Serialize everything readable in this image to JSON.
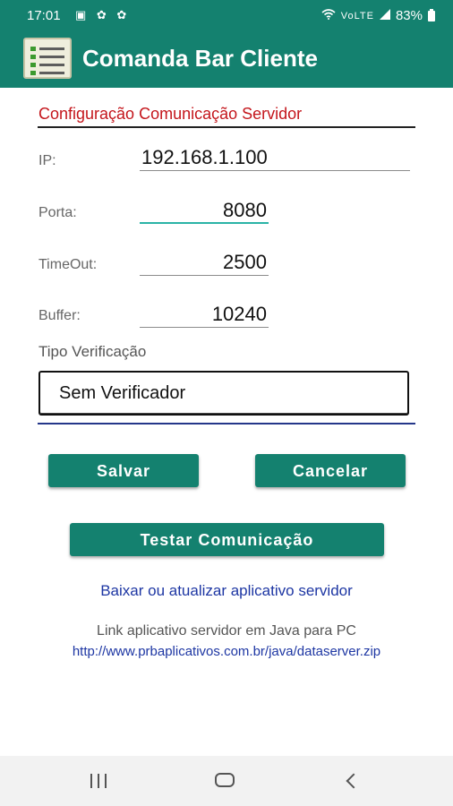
{
  "status": {
    "time": "17:01",
    "notification_icons": "▣ ✿ ✿",
    "network": "VoLTE",
    "battery": "83%"
  },
  "app": {
    "title": "Comanda Bar Cliente"
  },
  "form": {
    "section_title": "Configuração Comunicação Servidor",
    "ip": {
      "label": "IP:",
      "value": "192.168.1.100"
    },
    "porta": {
      "label": "Porta:",
      "value": "8080"
    },
    "timeout": {
      "label": "TimeOut:",
      "value": "2500"
    },
    "buffer": {
      "label": "Buffer:",
      "value": "10240"
    },
    "tipo_label": "Tipo Verificação",
    "tipo_value": "Sem Verificador"
  },
  "buttons": {
    "salvar": "Salvar",
    "cancelar": "Cancelar",
    "testar": "Testar Comunicação"
  },
  "links": {
    "download": "Baixar ou atualizar aplicativo servidor",
    "info": "Link aplicativo servidor em Java para PC",
    "url": "http://www.prbaplicativos.com.br/java/dataserver.zip"
  },
  "colors": {
    "primary": "#14816f",
    "accent_red": "#c4161c",
    "link_blue": "#1d36a3",
    "focus": "#2ab3a6"
  }
}
